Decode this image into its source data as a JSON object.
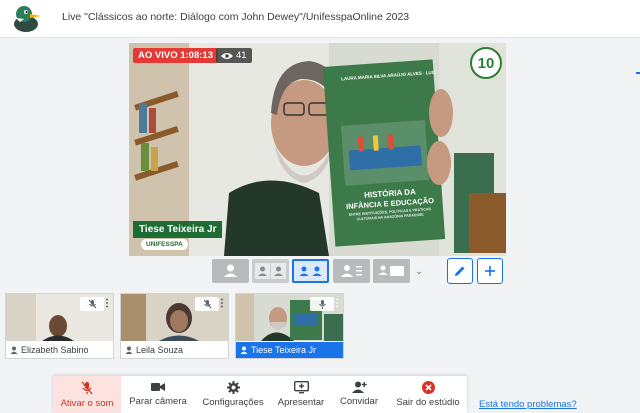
{
  "header": {
    "title": "Live \"Clássicos ao norte: Diálogo com John Dewey\"/UnifesspaOnline 2023"
  },
  "stage": {
    "live_label": "AO VIVO 1:08:13",
    "viewer_count": "41",
    "speaker_name": "Tiese Teixeira Jr",
    "speaker_org": "UNIFESSPA",
    "corner_logo_text": "10",
    "book": {
      "authors": "LAURA MARIA SILVA ARAÚJO ALVES · LUIZ CARLOS",
      "title_line1": "HISTÓRIA DA",
      "title_line2": "INFÂNCIA E EDUCAÇÃO",
      "subtitle": "ENTRE INSTITUIÇÕES, POLÍTICAS E PRÁTICAS CULTURAIS NA AMAZÔNIA PARAENSE"
    }
  },
  "layout_controls": {
    "options": [
      "single",
      "two-side",
      "two-split",
      "group-plus",
      "screen-share"
    ],
    "selected": "two-split"
  },
  "participants": [
    {
      "name": "Elizabeth Sabino",
      "muted": true,
      "active": false
    },
    {
      "name": "Leila Souza",
      "muted": true,
      "active": false
    },
    {
      "name": "Tiese Teixeira Jr",
      "muted": false,
      "active": true
    }
  ],
  "toolbar": {
    "unmute_label": "Ativar o som",
    "camera_label": "Parar câmera",
    "settings_label": "Configurações",
    "present_label": "Apresentar",
    "invite_label": "Convidar",
    "leave_label": "Sair do estúdio"
  },
  "help_link": "Está tendo problemas?",
  "colors": {
    "accent": "#1a73e8",
    "live_red": "#e53935",
    "brand_green": "#1e6b33",
    "danger": "#d93025"
  }
}
